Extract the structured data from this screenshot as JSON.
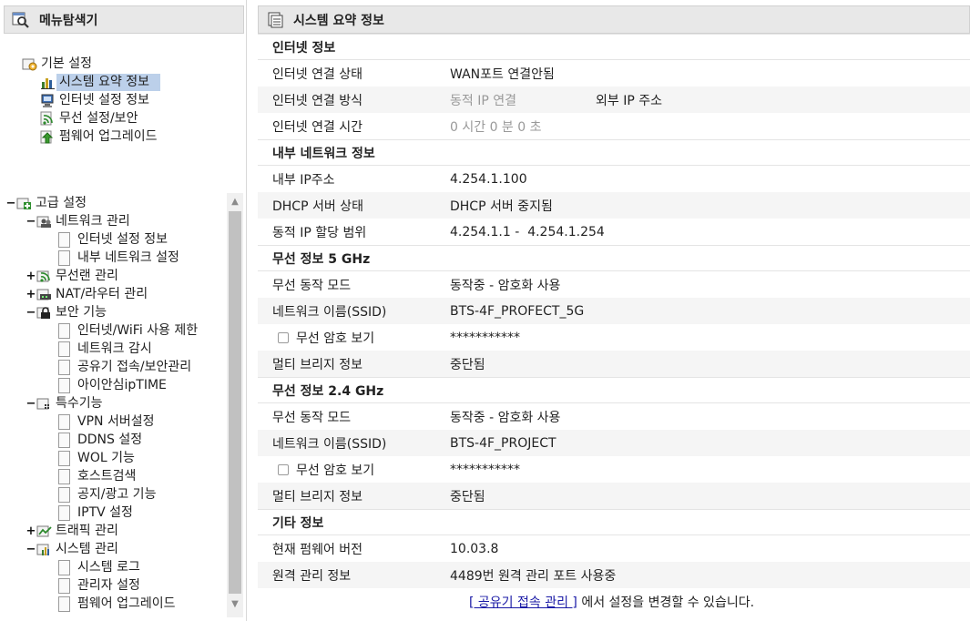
{
  "left": {
    "title": "메뉴탐색기",
    "basic": {
      "label": "기본 설정",
      "items": [
        "시스템 요약 정보",
        "인터넷 설정 정보",
        "무선 설정/보안",
        "펌웨어 업그레이드"
      ]
    },
    "advanced": {
      "toggle": "−",
      "label": "고급 설정",
      "network": {
        "toggle": "−",
        "label": "네트워크 관리",
        "items": [
          "인터넷 설정 정보",
          "내부 네트워크 설정"
        ]
      },
      "wlan": {
        "toggle": "+",
        "label": "무선랜 관리"
      },
      "nat": {
        "toggle": "+",
        "label": "NAT/라우터 관리"
      },
      "security": {
        "toggle": "−",
        "label": "보안 기능",
        "items": [
          "인터넷/WiFi 사용 제한",
          "네트워크 감시",
          "공유기 접속/보안관리",
          "아이안심ipTIME"
        ]
      },
      "special": {
        "toggle": "−",
        "label": "특수기능",
        "items": [
          "VPN 서버설정",
          "DDNS 설정",
          "WOL 기능",
          "호스트검색",
          "공지/광고 기능",
          "IPTV 설정"
        ]
      },
      "traffic": {
        "toggle": "+",
        "label": "트래픽 관리"
      },
      "system": {
        "toggle": "−",
        "label": "시스템 관리",
        "items": [
          "시스템 로그",
          "관리자 설정",
          "펌웨어 업그레이드"
        ]
      }
    }
  },
  "right": {
    "title": "시스템 요약 정보",
    "internet": {
      "header": "인터넷 정보",
      "status_label": "인터넷 연결 상태",
      "status_value": "WAN포트 연결안됨",
      "method_label": "인터넷 연결 방식",
      "method_value": "동적 IP 연결",
      "external_ip_label": "외부 IP 주소",
      "time_label": "인터넷 연결 시간",
      "time_value": "0 시간 0 분 0 초"
    },
    "lan": {
      "header": "내부 네트워크 정보",
      "ip_label": "내부 IP주소",
      "ip_value": "4.254.1.100",
      "dhcp_label": "DHCP 서버 상태",
      "dhcp_value": "DHCP 서버 중지됨",
      "range_label": "동적 IP 할당 범위",
      "range_value": "4.254.1.1 -  4.254.1.254"
    },
    "wifi5": {
      "header": "무선 정보 5 GHz",
      "mode_label": "무선 동작 모드",
      "mode_value": "동작중 - 암호화 사용",
      "ssid_label": "네트워크 이름(SSID)",
      "ssid_value": "BTS-4F_PROFECT_5G",
      "pw_label": "무선 암호 보기",
      "pw_value": "***********",
      "bridge_label": "멀티 브리지 정보",
      "bridge_value": "중단됨"
    },
    "wifi24": {
      "header": "무선 정보 2.4 GHz",
      "mode_label": "무선 동작 모드",
      "mode_value": "동작중 - 암호화 사용",
      "ssid_label": "네트워크 이름(SSID)",
      "ssid_value": "BTS-4F_PROJECT",
      "pw_label": "무선 암호 보기",
      "pw_value": "***********",
      "bridge_label": "멀티 브리지 정보",
      "bridge_value": "중단됨"
    },
    "etc": {
      "header": "기타 정보",
      "fw_label": "현재 펌웨어 버전",
      "fw_value": "10.03.8",
      "remote_label": "원격 관리 정보",
      "remote_value": "4489번 원격 관리 포트 사용중",
      "foot_link": "[ 공유기 접속 관리 ]",
      "foot_text": " 에서 설정을 변경할 수 있습니다."
    }
  }
}
